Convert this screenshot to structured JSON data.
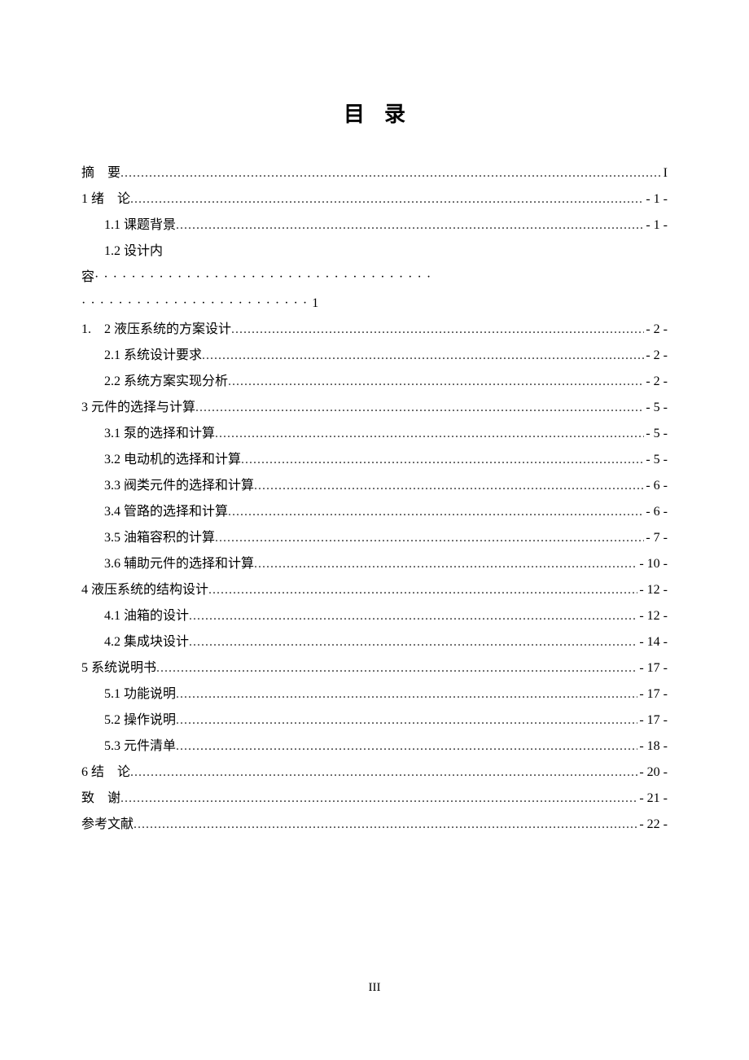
{
  "title": "目录",
  "entries": [
    {
      "label": "摘　要",
      "page": "I",
      "indent": false
    },
    {
      "label": "1 绪　论",
      "page": "- 1 -",
      "indent": false
    },
    {
      "label": "1.1 课题背景",
      "page": "- 1 -",
      "indent": true
    },
    {
      "label_line1": "1.2 设计内",
      "label_line2": "容",
      "page_suffix": "1",
      "indent": true,
      "wrapped": true
    },
    {
      "label": "1.　2 液压系统的方案设计",
      "page": "- 2 -",
      "indent": false
    },
    {
      "label": "2.1 系统设计要求",
      "page": "- 2 -",
      "indent": true
    },
    {
      "label": "2.2 系统方案实现分析",
      "page": "- 2 -",
      "indent": true
    },
    {
      "label": "3 元件的选择与计算",
      "page": "- 5 -",
      "indent": false
    },
    {
      "label": "3.1 泵的选择和计算",
      "page": "- 5 -",
      "indent": true
    },
    {
      "label": "3.2 电动机的选择和计算",
      "page": "- 5 -",
      "indent": true
    },
    {
      "label": "3.3 阀类元件的选择和计算",
      "page": "- 6 -",
      "indent": true
    },
    {
      "label": "3.4 管路的选择和计算",
      "page": "- 6 -",
      "indent": true
    },
    {
      "label": "3.5 油箱容积的计算",
      "page": "- 7 -",
      "indent": true
    },
    {
      "label": "3.6 辅助元件的选择和计算",
      "page": "- 10 -",
      "indent": true
    },
    {
      "label": "4 液压系统的结构设计",
      "page": "- 12 -",
      "indent": false
    },
    {
      "label": "4.1 油箱的设计",
      "page": "- 12 -",
      "indent": true
    },
    {
      "label": "4.2 集成块设计",
      "page": "- 14 -",
      "indent": true
    },
    {
      "label": "5 系统说明书",
      "page": "- 17 -",
      "indent": false
    },
    {
      "label": "5.1 功能说明",
      "page": "- 17 -",
      "indent": true
    },
    {
      "label": "5.2 操作说明",
      "page": "- 17 -",
      "indent": true
    },
    {
      "label": "5.3 元件清单",
      "page": "- 18 -",
      "indent": true
    },
    {
      "label": "6 结　论",
      "page": "- 20 -",
      "indent": false
    },
    {
      "label": "致　谢",
      "page": "- 21 -",
      "indent": false
    },
    {
      "label": "参考文献",
      "page": "- 22 -",
      "indent": false
    }
  ],
  "wide_dots_line1": "·····································",
  "wide_dots_line2": "·························",
  "page_number": "III"
}
